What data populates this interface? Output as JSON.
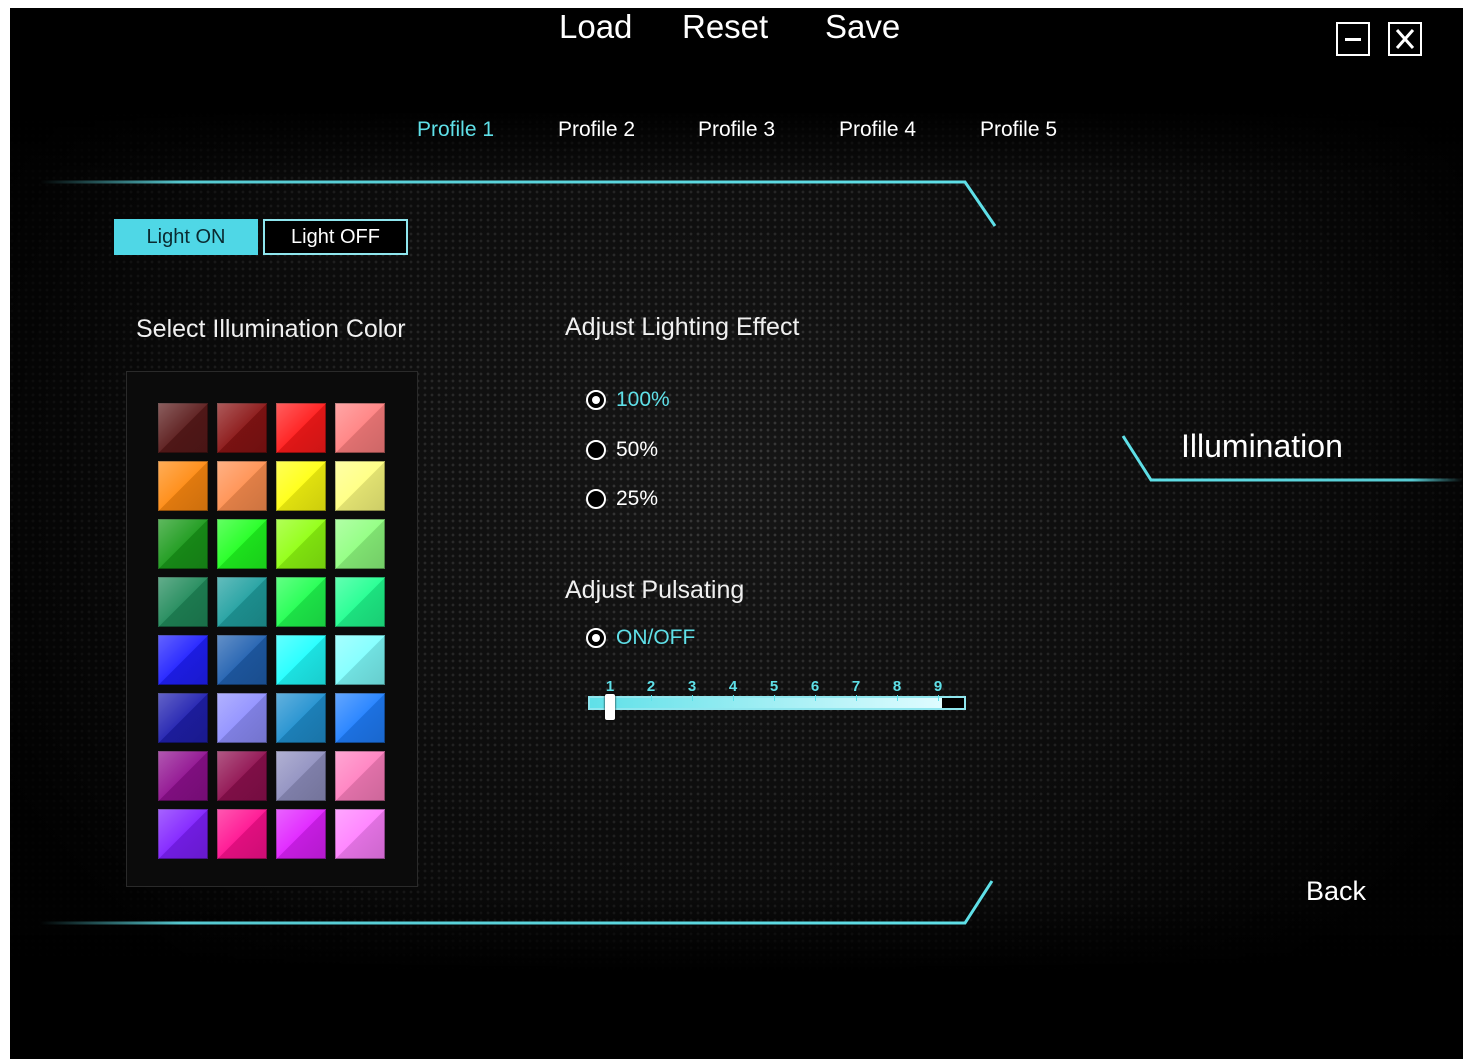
{
  "header": {
    "menu": {
      "load": "Load",
      "reset": "Reset",
      "save": "Save"
    },
    "window_controls": {
      "minimize_glyph": "—",
      "close_glyph": "X"
    }
  },
  "profiles": {
    "tabs": [
      "Profile 1",
      "Profile 2",
      "Profile 3",
      "Profile 4",
      "Profile 5"
    ],
    "active_index": 0
  },
  "light_toggle": {
    "on_label": "Light ON",
    "off_label": "Light OFF",
    "selected": "on"
  },
  "color_section": {
    "title": "Select Illumination Color",
    "swatches": [
      [
        "#5a1a1a",
        "#8a1414",
        "#ff1a1a",
        "#ff8080"
      ],
      [
        "#ff8a10",
        "#ff9050",
        "#ffff10",
        "#ffff80"
      ],
      [
        "#1a9a1a",
        "#20ff20",
        "#90ff10",
        "#90ff80"
      ],
      [
        "#208a5a",
        "#20a0a0",
        "#20ff50",
        "#20ff90"
      ],
      [
        "#2020ff",
        "#2060b0",
        "#20ffff",
        "#80ffff"
      ],
      [
        "#2020b0",
        "#9090ff",
        "#2090d0",
        "#2080ff"
      ],
      [
        "#901090",
        "#901050",
        "#9090c0",
        "#ff80c0"
      ],
      [
        "#8020ff",
        "#ff1090",
        "#e020ff",
        "#ff80ff"
      ]
    ]
  },
  "effect_section": {
    "title": "Adjust Lighting Effect",
    "options": [
      "100%",
      "50%",
      "25%"
    ],
    "selected_index": 0
  },
  "pulsating_section": {
    "title": "Adjust Pulsating",
    "toggle_label": "ON/OFF",
    "toggle_selected": true,
    "ticks": [
      "1",
      "2",
      "3",
      "4",
      "5",
      "6",
      "7",
      "8",
      "9"
    ],
    "value": 1
  },
  "side_panel": {
    "title": "Illumination",
    "back_label": "Back"
  },
  "colors": {
    "accent": "#5fe0e8",
    "background": "#000000"
  }
}
